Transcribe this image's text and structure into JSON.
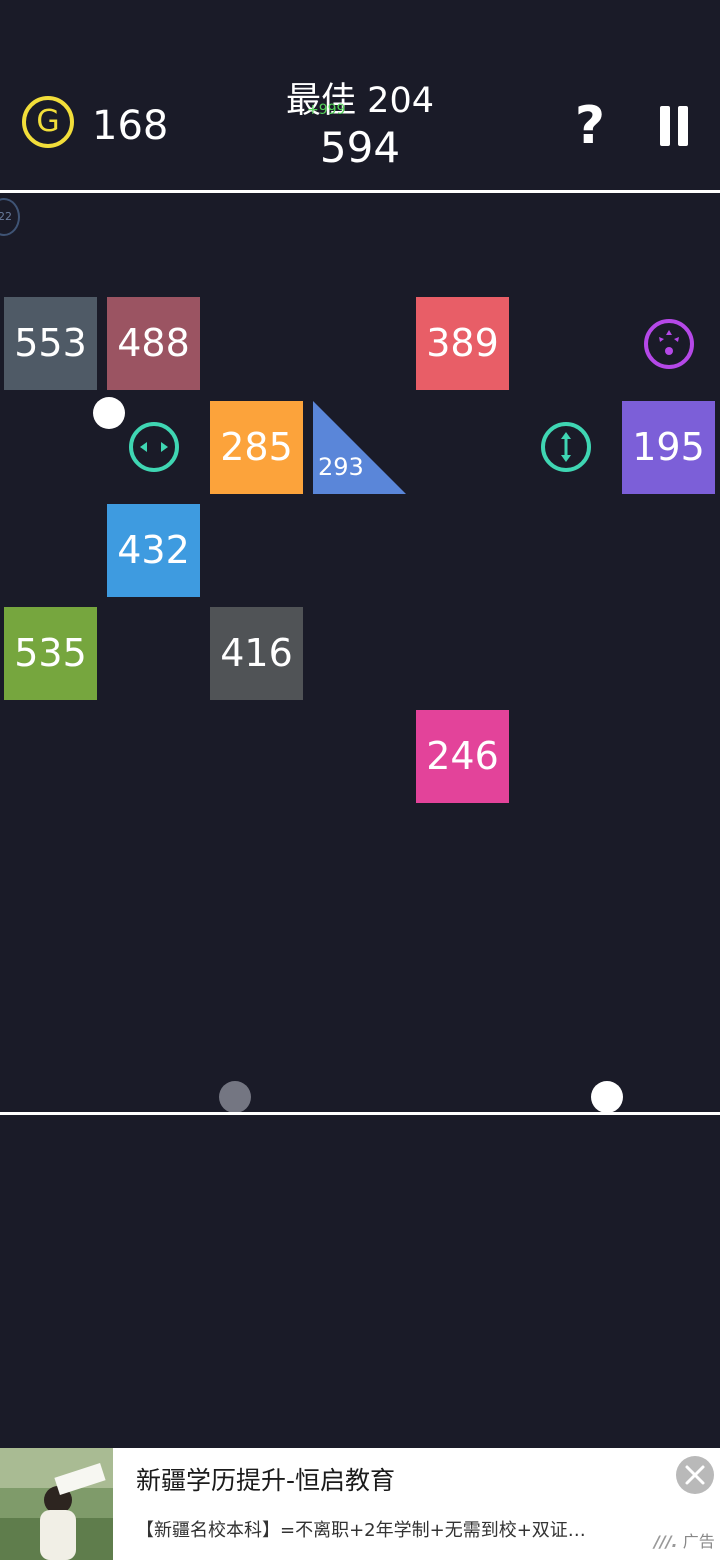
{
  "header": {
    "coin_letter": "G",
    "coins": "168",
    "best_label": "最佳",
    "best_value": "204",
    "best_overlay": "+999",
    "score": "594",
    "help_label": "?"
  },
  "ball_count": "22",
  "blocks": [
    {
      "id": "553",
      "value": "553",
      "color": "#4f5a66"
    },
    {
      "id": "488",
      "value": "488",
      "color": "#9b5462"
    },
    {
      "id": "389",
      "value": "389",
      "color": "#e85e67"
    },
    {
      "id": "285",
      "value": "285",
      "color": "#fca33b"
    },
    {
      "id": "195",
      "value": "195",
      "color": "#7c5fd8"
    },
    {
      "id": "432",
      "value": "432",
      "color": "#3e9be0"
    },
    {
      "id": "535",
      "value": "535",
      "color": "#76a63e"
    },
    {
      "id": "416",
      "value": "416",
      "color": "#505356"
    },
    {
      "id": "246",
      "value": "246",
      "color": "#e3439a"
    }
  ],
  "triangle_block": {
    "value": "293",
    "color": "#5a86d9"
  },
  "powerups": [
    {
      "name": "horizontal-laser-icon",
      "color": "#3fd6b3"
    },
    {
      "name": "vertical-laser-icon",
      "color": "#3fd6b3"
    },
    {
      "name": "scatter-icon",
      "color": "#b548e8"
    }
  ],
  "ad": {
    "title": "新疆学历提升-恒启教育",
    "description": "【新疆名校本科】=不离职+2年学制+无需到校+双证…",
    "label": "广告"
  }
}
